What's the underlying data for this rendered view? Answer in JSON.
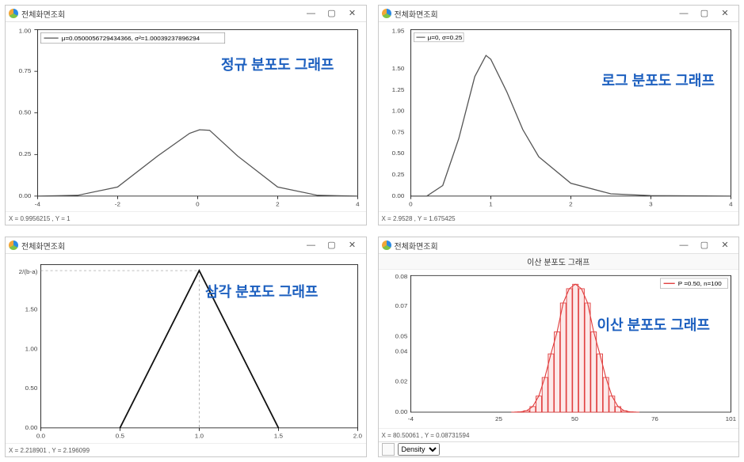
{
  "windows": {
    "normal": {
      "title": "전체화면조회",
      "overlay": "정규 분포도 그래프",
      "legend": "μ=0.0500056729434366, σ²=1.00039237896294",
      "status": "X = 0.9956215 , Y = 1",
      "x_ticks": [
        "-4",
        "-2",
        "0",
        "2",
        "4"
      ],
      "y_ticks": [
        "0.00",
        "0.25",
        "0.50",
        "0.75",
        "1.00"
      ]
    },
    "log": {
      "title": "전체화면조회",
      "overlay": "로그 분포도 그래프",
      "legend": "μ=0, σ=0.25",
      "status": "X = 2.9528 , Y = 1.675425",
      "x_ticks": [
        "0",
        "1",
        "2",
        "3",
        "4"
      ],
      "y_ticks": [
        "0.00",
        "0.25",
        "0.50",
        "0.75",
        "1.00",
        "1.25",
        "1.50",
        "1.95"
      ]
    },
    "tri": {
      "title": "전체화면조회",
      "overlay": "삼각 분포도 그래프",
      "legend": "",
      "status": "X = 2.218901 , Y = 2.196099",
      "x_ticks": [
        "0.0",
        "0.5",
        "1.0",
        "1.5",
        "2.0"
      ],
      "y_ticks": [
        "0.00",
        "0.50",
        "1.00",
        "1.50",
        "2/(b-a)"
      ],
      "y_peak_label": "2/(b-a)"
    },
    "discrete": {
      "title": "전체화면조회",
      "chart_title": "이산 분포도 그래프",
      "overlay": "이산 분포도 그래프",
      "legend": "P =0.50, n=100",
      "status": "X = 80.50061 , Y = 0.08731594",
      "x_ticks": [
        "-4",
        "25",
        "50",
        "76",
        "101"
      ],
      "y_ticks": [
        "0.00",
        "0.02",
        "0.04",
        "0.05",
        "0.07",
        "0.08"
      ],
      "toolbar_select": "Density"
    }
  },
  "chart_data": [
    {
      "name": "normal",
      "type": "line",
      "title": "정규 분포도 그래프",
      "legend": "μ=0.0500056729434366, σ²=1.00039237896294",
      "xlabel": "",
      "ylabel": "",
      "xlim": [
        -4,
        4
      ],
      "ylim": [
        0,
        1
      ],
      "curve": "Normal PDF with μ≈0.05, σ²≈1.00039 (σ≈1.0002)",
      "series": [
        {
          "name": "pdf",
          "x": [
            -4,
            -3,
            -2,
            -1,
            0,
            0.05,
            1,
            2,
            3,
            4
          ],
          "y": [
            0.0001,
            0.0044,
            0.054,
            0.242,
            0.398,
            0.399,
            0.242,
            0.054,
            0.0044,
            0.0001
          ]
        }
      ]
    },
    {
      "name": "lognormal",
      "type": "line",
      "title": "로그 분포도 그래프",
      "legend": "μ=0, σ=0.25",
      "xlabel": "",
      "ylabel": "",
      "xlim": [
        0,
        4
      ],
      "ylim": [
        0,
        1.95
      ],
      "curve": "Log-normal PDF with μ=0, σ=0.25. Mode ≈ e^{-σ²} ≈ 0.94, peak ≈ 1.65",
      "series": [
        {
          "name": "pdf",
          "x": [
            0.01,
            0.2,
            0.4,
            0.6,
            0.8,
            0.94,
            1.0,
            1.2,
            1.4,
            1.6,
            2.0,
            2.5,
            3.0,
            4.0
          ],
          "y": [
            0.0,
            0.002,
            0.12,
            0.67,
            1.4,
            1.65,
            1.6,
            1.22,
            0.78,
            0.46,
            0.15,
            0.03,
            0.006,
            0.0003
          ]
        }
      ]
    },
    {
      "name": "triangular",
      "type": "line",
      "title": "삼각 분포도 그래프",
      "xlabel": "",
      "ylabel": "",
      "xlim": [
        0,
        2
      ],
      "ylim": [
        0,
        "2/(b-a)"
      ],
      "params": {
        "a": 0.5,
        "c": 1.0,
        "b": 1.5,
        "peak_height_label": "2/(b-a)",
        "peak_height_value": 2.0
      },
      "series": [
        {
          "name": "pdf",
          "x": [
            0.5,
            1.0,
            1.5
          ],
          "y": [
            0,
            2.0,
            0
          ]
        }
      ]
    },
    {
      "name": "discrete_binomial",
      "type": "bar",
      "title": "이산 분포도 그래프",
      "legend": "P =0.50, n=100",
      "xlabel": "",
      "ylabel": "",
      "xlim": [
        -4,
        101
      ],
      "ylim": [
        0,
        0.08
      ],
      "distribution": "Binomial(n=100, p=0.50), bars for k=30..70, peak≈0.0796 at k=50",
      "series": [
        {
          "name": "pmf",
          "color": "#e03a3a",
          "x": [
            30,
            32,
            34,
            36,
            38,
            40,
            42,
            44,
            46,
            48,
            50,
            52,
            54,
            56,
            58,
            60,
            62,
            64,
            66,
            68,
            70
          ],
          "y": [
            2.3e-05,
            0.00017,
            0.0009,
            0.00349,
            0.01001,
            0.02159,
            0.03626,
            0.04998,
            0.0679,
            0.07681,
            0.0796,
            0.07681,
            0.0679,
            0.04998,
            0.03626,
            0.02159,
            0.01001,
            0.00349,
            0.0009,
            0.00017,
            2.3e-05
          ]
        }
      ]
    }
  ]
}
